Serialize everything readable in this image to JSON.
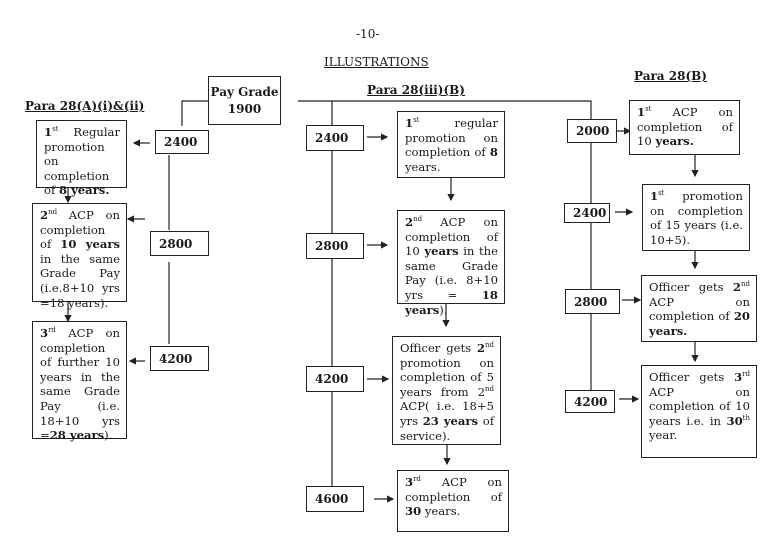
{
  "page_number": "-10-",
  "title": "ILLUSTRATIONS",
  "root": {
    "line1": "Pay Grade",
    "line2": "1900"
  },
  "sections": [
    {
      "heading": "Para 28(A)(i)&(ii)",
      "grades": [
        "2400",
        "2800",
        "4200"
      ],
      "steps": [
        {
          "parts": [
            "1",
            "st",
            " Regular promotion on completion of ",
            "8 years."
          ]
        },
        {
          "parts": [
            "2",
            "nd",
            " ACP on completion of ",
            "10 years",
            " in the same Grade Pay (i.e.8+10 yrs =18 years)."
          ]
        },
        {
          "parts": [
            "3",
            "rd",
            " ACP on completion of further 10 years in the same Grade Pay (i.e. 18+10 yrs =",
            "28 years",
            ")."
          ]
        }
      ]
    },
    {
      "heading": "Para 28(iii)(B)",
      "grades": [
        "2400",
        "2800",
        "4200",
        "4600"
      ],
      "steps": [
        {
          "parts": [
            "1",
            "st",
            " regular promotion on completion of ",
            "8",
            " years."
          ]
        },
        {
          "parts": [
            "2",
            "nd",
            " ACP on completion of 10 ",
            "years",
            " in the same Grade Pay (i.e. 8+10 yrs = ",
            "18 years",
            ")."
          ]
        },
        {
          "parts": [
            "Officer gets ",
            "2",
            "nd",
            " promotion on completion of 5 years from 2",
            "nd",
            " ACP( i.e. 18+5 yrs ",
            "23 years",
            " of service)."
          ]
        },
        {
          "parts": [
            "3",
            "rd",
            " ACP on completion of ",
            "30",
            " years."
          ]
        }
      ]
    },
    {
      "heading": "Para 28(B)",
      "grades": [
        "2000",
        "2400",
        "2800",
        "4200"
      ],
      "steps": [
        {
          "parts": [
            "1",
            "st",
            " ACP on completion of 10 ",
            "years."
          ]
        },
        {
          "parts": [
            "1",
            "st",
            " promotion on completion of 15 years (i.e. 10+5)."
          ]
        },
        {
          "parts": [
            "Officer gets ",
            "2",
            "nd",
            " ACP on completion of ",
            "20 years."
          ]
        },
        {
          "parts": [
            "Officer gets ",
            "3",
            "rd",
            " ACP on completion of 10 years i.e. in ",
            "30",
            "th",
            " year."
          ]
        }
      ]
    }
  ]
}
